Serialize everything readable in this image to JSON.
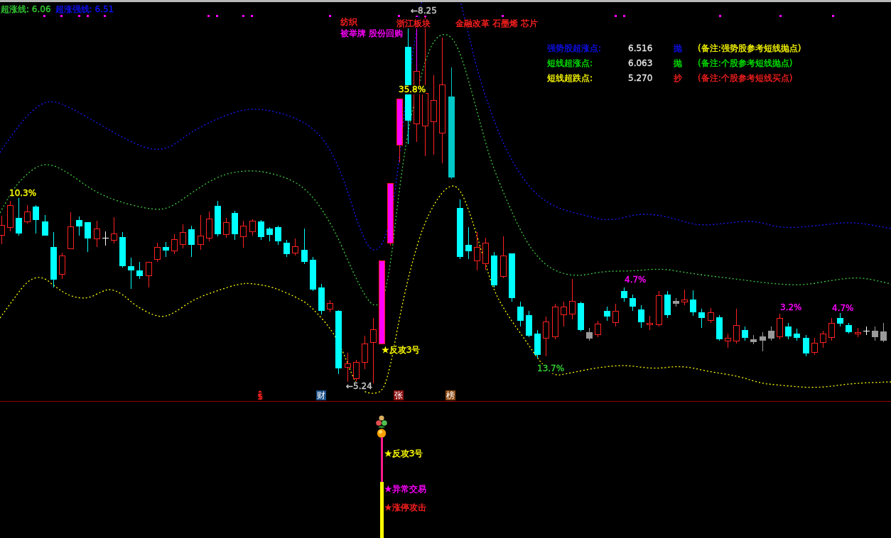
{
  "indicator_header": [
    {
      "text": "超涨线: 6.06",
      "color": "#33cc33"
    },
    {
      "text": "超涨强线: 6.51",
      "color": "#1010ff"
    }
  ],
  "chart_annotations": [
    {
      "text": "纺织",
      "color": "#ff2020"
    },
    {
      "text": "被举牌 股份回购",
      "color": "#ff00ff"
    },
    {
      "text": "浙江板块",
      "color": "#ff2020"
    },
    {
      "text": "金融改革 石墨烯 芯片",
      "color": "#ff2020"
    }
  ],
  "price_markers": {
    "high": "←8.25",
    "low": "←5.24"
  },
  "percent_labels": [
    {
      "text": "10.3%",
      "color": "#ffff00"
    },
    {
      "text": "35.8%",
      "color": "#ffff00"
    },
    {
      "text": "13.7%",
      "color": "#33cc33"
    },
    {
      "text": "4.7%",
      "color": "#ff00ff"
    },
    {
      "text": "3.2%",
      "color": "#ff00ff"
    },
    {
      "text": "4.7%",
      "color": "#ff00ff"
    }
  ],
  "signal_label": "★反攻3号",
  "legend": [
    {
      "kind": "strong_sell",
      "label": "强势股超涨点:",
      "value": "6.516",
      "action": "抛",
      "note": "(备注:强势股参考短线抛点)"
    },
    {
      "kind": "sell",
      "label": "短线超涨点:",
      "value": "6.063",
      "action": "抛",
      "note": "(备注:个股参考短线抛点)"
    },
    {
      "kind": "buy",
      "label": "短线超跌点:",
      "value": "5.270",
      "action": "抄",
      "note": "(备注:个股参考短线买点)"
    }
  ],
  "event_badges": [
    {
      "kind": "dollar"
    },
    {
      "kind": "text",
      "text": "财",
      "color": "#1c4e86"
    },
    {
      "kind": "text",
      "text": "张",
      "color": "#8b1010"
    },
    {
      "kind": "text",
      "text": "榜",
      "color": "#8b4a14"
    }
  ],
  "lower_pane": {
    "signals": [
      {
        "text": "★反攻3号",
        "color": "#ffff00"
      },
      {
        "text": "★异常交易",
        "color": "#ff00ff"
      },
      {
        "text": "★涨停攻击",
        "color": "#ff2020"
      }
    ]
  }
}
